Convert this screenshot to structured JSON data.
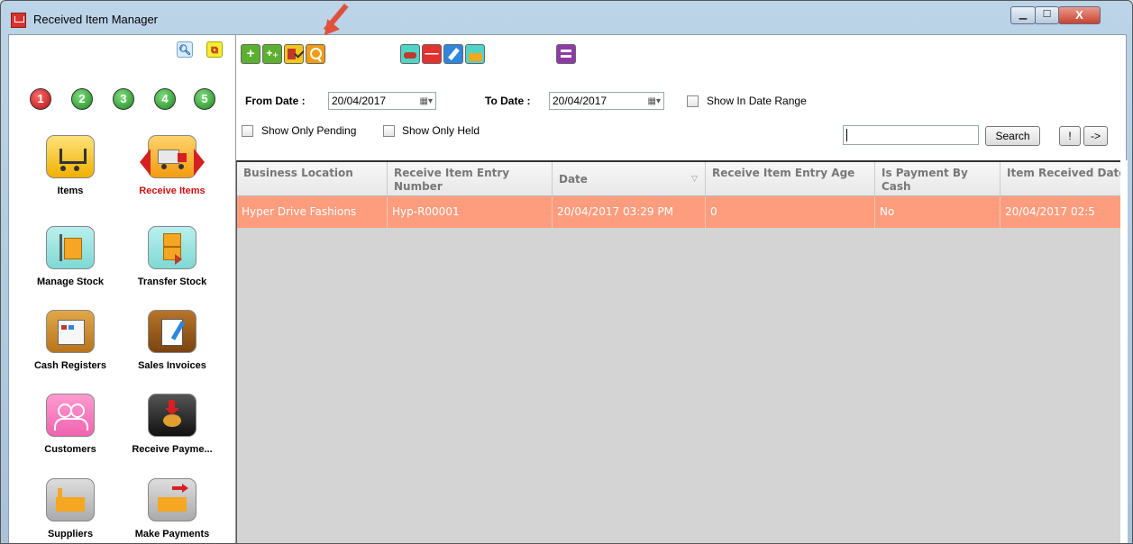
{
  "window": {
    "title": "Received Item Manager",
    "minimize": "▁",
    "maximize": "☐",
    "close": "X"
  },
  "sidebar": {
    "steps": [
      "1",
      "2",
      "3",
      "4",
      "5"
    ],
    "modules": [
      {
        "label": "Items"
      },
      {
        "label": "Receive Items",
        "active": true
      },
      {
        "label": "Manage Stock"
      },
      {
        "label": "Transfer Stock"
      },
      {
        "label": "Cash Registers"
      },
      {
        "label": "Sales Invoices"
      },
      {
        "label": "Customers"
      },
      {
        "label": "Receive Payme..."
      },
      {
        "label": "Suppliers"
      },
      {
        "label": "Make Payments"
      }
    ]
  },
  "toolbar": {
    "add": "+",
    "add_multi": "+₊",
    "remove": "—",
    "help": "?"
  },
  "filters": {
    "from_label": "From Date :",
    "from_value": "20/04/2017",
    "to_label": "To Date :",
    "to_value": "20/04/2017",
    "show_in_range": "Show In Date Range",
    "show_pending": "Show Only Pending",
    "show_held": "Show Only Held",
    "search_value": "",
    "search_button": "Search",
    "exclaim_button": "!",
    "arrow_button": "->"
  },
  "grid": {
    "columns": [
      "Business Location",
      "Receive Item Entry Number",
      "Date",
      "Receive Item Entry Age",
      "Is Payment By Cash",
      "Item Received Date"
    ],
    "rows": [
      [
        "Hyper Drive Fashions",
        "Hyp-R00001",
        "20/04/2017 03:29 PM",
        "0",
        "No",
        "20/04/2017 02:5"
      ]
    ]
  },
  "colors": {
    "selected_row": "#fd9d7d",
    "accent_red": "#d42020"
  }
}
